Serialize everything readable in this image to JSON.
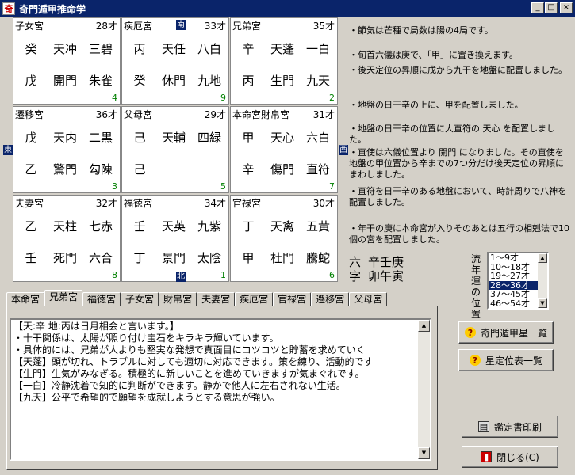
{
  "window": {
    "title": "奇門遁甲推命学",
    "app_icon_glyph": "奇",
    "btn_min": "_",
    "btn_max": "□",
    "btn_close": "×"
  },
  "directions": {
    "south": "南",
    "east": "東",
    "west": "西",
    "north": "北"
  },
  "palaces": [
    {
      "name": "子女宮",
      "age": "28才",
      "top": [
        "癸",
        "天冲",
        "三碧"
      ],
      "bottom": [
        "戊",
        "開門",
        "朱雀"
      ],
      "num": "4"
    },
    {
      "name": "疾厄宮",
      "age": "33才",
      "top": [
        "丙",
        "天任",
        "八白"
      ],
      "bottom": [
        "癸",
        "休門",
        "九地"
      ],
      "num": "9"
    },
    {
      "name": "兄弟宮",
      "age": "35才",
      "top": [
        "辛",
        "天蓬",
        "一白"
      ],
      "bottom": [
        "丙",
        "生門",
        "九天"
      ],
      "num": "2"
    },
    {
      "name": "遷移宮",
      "age": "36才",
      "top": [
        "戊",
        "天内",
        "二黒"
      ],
      "bottom": [
        "乙",
        "驚門",
        "勾陳"
      ],
      "num": "3"
    },
    {
      "name": "父母宮",
      "age": "29才",
      "top": [
        "己",
        "天輔",
        "四緑"
      ],
      "bottom": [
        "己",
        "",
        ""
      ],
      "num": "5"
    },
    {
      "name": "本命宮財帛宮",
      "age": "31才",
      "top": [
        "甲",
        "天心",
        "六白"
      ],
      "bottom": [
        "辛",
        "傷門",
        "直符"
      ],
      "num": "7"
    },
    {
      "name": "夫妻宮",
      "age": "32才",
      "top": [
        "乙",
        "天柱",
        "七赤"
      ],
      "bottom": [
        "壬",
        "死門",
        "六合"
      ],
      "num": "8"
    },
    {
      "name": "福徳宮",
      "age": "34才",
      "top": [
        "壬",
        "天英",
        "九紫"
      ],
      "bottom": [
        "丁",
        "景門",
        "太陰"
      ],
      "num": "1"
    },
    {
      "name": "官禄宮",
      "age": "30才",
      "top": [
        "丁",
        "天禽",
        "五黄"
      ],
      "bottom": [
        "甲",
        "杜門",
        "騰蛇"
      ],
      "num": "6"
    }
  ],
  "notes": [
    "・節気は芒種で局数は陽の4局です。",
    "・旬首六儀は庚で、「甲」に置き換えます。",
    "・後天定位の昇順に戊から九干を地盤に配置しました。",
    "・地盤の日干辛の上に、甲を配置しました。",
    "・地盤の日干辛の位置に大直符の 天心 を配置しました。",
    "・直使は六儀位置より 開門 になりました。その直使を地盤の甲位置から辛までの7つ分だけ後天定位の昇順にまわしました。",
    "・直符を日干辛のある地盤において、時計周りで八神を配置しました。",
    "・年干の庚に本命宮が入りそのあとは五行の相剋法で10個の宮を配置しました。"
  ],
  "summary": {
    "label1": "六",
    "value1": "辛壬庚",
    "label2": "字",
    "value2": "卯午寅"
  },
  "period": {
    "label": "流年運の位置",
    "options": [
      "1〜9才",
      "10〜18才",
      "19〜27才",
      "28〜36才",
      "37〜45才",
      "46〜54才"
    ],
    "selected": "28〜36才"
  },
  "tabs": [
    "本命宮",
    "兄弟宮",
    "福徳宮",
    "子女宮",
    "財帛宮",
    "夫妻宮",
    "疾厄宮",
    "官禄宮",
    "遷移宮",
    "父母宮"
  ],
  "active_tab": "兄弟宮",
  "reading": [
    "【天:辛 地:丙は日月相会と言います。】",
    "・十干関係は、太陽が照り付け宝石をキラキラ輝いています。",
    "・具体的には、兄弟が人よりも堅実な発想で真面目にコツコツと貯蓄を求めていく",
    "【天蓬】頭が切れ、トラブルに対しても適切に対応できます。策を練り、活動的です",
    "【生門】生気がみなぎる。積極的に新しいことを進めていきますが気まぐれです。",
    "【一白】冷静沈着で知的に判断ができます。静かで他人に左右されない生活。",
    "【九天】公平で希望的で願望を成就しようとする意思が強い。"
  ],
  "buttons": {
    "list1": "奇門遁甲星一覧",
    "list2": "星定位表一覧",
    "print": "鑑定書印刷",
    "close": "閉じる(C)"
  },
  "colors": {
    "titlebar": "#0a246a",
    "selection": "#0a246a",
    "face": "#d4d0c8",
    "cell_number": "#008000"
  }
}
